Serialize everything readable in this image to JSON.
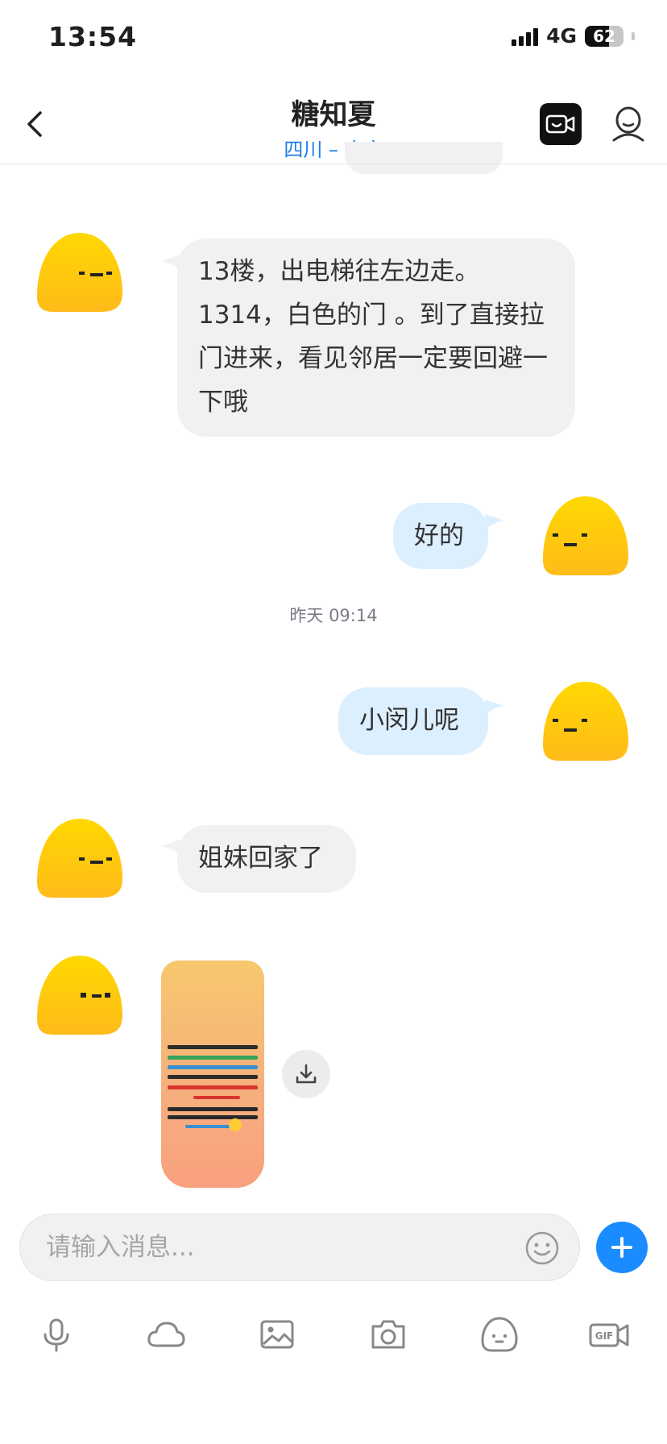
{
  "status_bar": {
    "time": "13:54",
    "network": "4G",
    "battery": "62",
    "battery_level": 0.62
  },
  "header": {
    "title": "糖知夏",
    "subtitle": "四川 – 南充"
  },
  "messages": [
    {
      "side": "left",
      "text": "13楼，出电梯往左边走。1314，白色的门 。到了直接拉门进来，看见邻居一定要回避一下哦"
    },
    {
      "side": "right",
      "text": "好的"
    },
    {
      "side": "center",
      "text": "昨天 09:14"
    },
    {
      "side": "right",
      "text": "小闵儿呢"
    },
    {
      "side": "left",
      "text": "姐妹回家了"
    },
    {
      "side": "left",
      "type": "image"
    }
  ],
  "input": {
    "placeholder": "请输入消息..."
  },
  "toolbar": {
    "icons": [
      "microphone-icon",
      "cloud-icon",
      "image-icon",
      "camera-icon",
      "sticker-icon",
      "gif-icon"
    ]
  },
  "colors": {
    "accent": "#1a8cff",
    "my_bubble": "#dcefff",
    "other_bubble": "#f1f1f3",
    "avatar": "#ffd400"
  }
}
